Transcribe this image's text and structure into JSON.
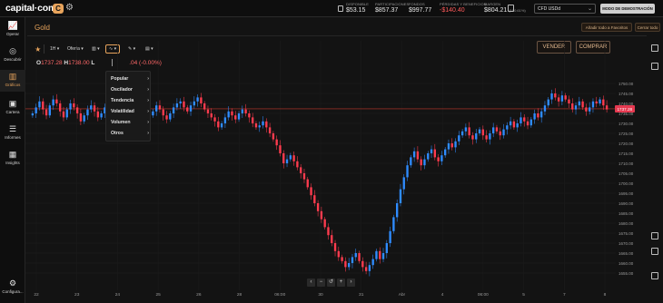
{
  "app": {
    "logo": "capital·com",
    "logo_badge": "C",
    "settings_icon": "gear-icon"
  },
  "account_stats": [
    {
      "label": "DISPONIBLE",
      "value": "$53.15",
      "sub": ""
    },
    {
      "label": "PARTICIPACIONES",
      "value": "$857.37",
      "sub": ""
    },
    {
      "label": "FONDOS",
      "value": "$997.77",
      "sub": ""
    },
    {
      "label": "PÉRDIDAS Y BENEFICIOS",
      "value": "-$140.40",
      "sub": ""
    },
    {
      "label": "MARGEN",
      "value": "$804.21",
      "sub": "(100.61%)"
    }
  ],
  "account_select": "CFD USDd",
  "demo_mode": "MODO DE DEMOSTRACIÓN",
  "nav": [
    {
      "label": "Operar",
      "icon": "chart-line-icon"
    },
    {
      "label": "Descubrir",
      "icon": "compass-icon"
    },
    {
      "label": "Gráficos",
      "icon": "candles-icon"
    },
    {
      "label": "Cartera",
      "icon": "briefcase-icon"
    },
    {
      "label": "Informes",
      "icon": "report-icon"
    },
    {
      "label": "Insights",
      "icon": "insights-icon"
    },
    {
      "label": "Configura...",
      "icon": "settings-icon"
    }
  ],
  "instrument": "Gold",
  "header_buttons": {
    "favorites": "Añadir todo a Favoritos",
    "close_all": "Cerrar todo"
  },
  "toolbar": {
    "timeframe": "1H",
    "price_type": "Oferta",
    "chart_type_icon": "candles-icon",
    "indicators_icon": "indicators-icon",
    "draw_icon": "pencil-icon",
    "template_icon": "layers-icon"
  },
  "trade": {
    "sell": "VENDER",
    "buy": "COMPRAR"
  },
  "ohlc": {
    "o_label": "O",
    "o": "1737.28",
    "h_label": "H",
    "h": "1738.00",
    "l_label": "L",
    "change": ".04 (-0.00%)"
  },
  "indicator_menu": [
    "Popular",
    "Oscilador",
    "Tendencia",
    "Volatilidad",
    "Volumen",
    "Otros"
  ],
  "colors": {
    "accent": "#e8a45c",
    "up": "#2f8cff",
    "down": "#ff3b4e",
    "price_tag": "#e53950",
    "price_line": "#c0392b"
  },
  "chart_data": {
    "type": "candlestick",
    "instrument": "Gold",
    "current_price_label": "1737.28",
    "ylim": [
      1650,
      1760
    ],
    "y_ticks": [
      1750,
      1745,
      1740,
      1735,
      1730,
      1725,
      1720,
      1715,
      1710,
      1705,
      1700,
      1695,
      1690,
      1685,
      1680,
      1675,
      1670,
      1665,
      1660,
      1655
    ],
    "x_ticks": [
      "22",
      "23",
      "24",
      "25",
      "26",
      "28",
      "06:00",
      "30",
      "31",
      "Abr",
      "4",
      "06:00",
      "5",
      "7",
      "8"
    ],
    "current_price": 1737.28,
    "series": [
      {
        "values": [
          1735,
          1738,
          1741,
          1737,
          1734,
          1739,
          1742,
          1740,
          1736,
          1733,
          1737,
          1740,
          1738,
          1735,
          1731,
          1734,
          1737,
          1739,
          1736,
          1733,
          1735,
          1738,
          1741,
          1739,
          1742,
          1744,
          1740,
          1737,
          1734,
          1731,
          1728,
          1732,
          1735,
          1737,
          1734,
          1736,
          1739,
          1737,
          1734,
          1732,
          1735,
          1738,
          1740,
          1741,
          1738,
          1736,
          1739,
          1741,
          1743,
          1740,
          1737,
          1735,
          1733,
          1731,
          1728,
          1730,
          1733,
          1736,
          1734,
          1732,
          1735,
          1737,
          1735,
          1733,
          1730,
          1728,
          1729,
          1731,
          1728,
          1725,
          1722,
          1719,
          1715,
          1710,
          1712,
          1714,
          1711,
          1708,
          1705,
          1702,
          1698,
          1694,
          1690,
          1686,
          1682,
          1678,
          1674,
          1670,
          1666,
          1663,
          1661,
          1658,
          1660,
          1663,
          1665,
          1661,
          1658,
          1656,
          1659,
          1662,
          1666,
          1662,
          1665,
          1670,
          1676,
          1683,
          1690,
          1697,
          1703,
          1709,
          1713,
          1716,
          1712,
          1709,
          1712,
          1715,
          1717,
          1713,
          1711,
          1714,
          1717,
          1720,
          1718,
          1721,
          1724,
          1726,
          1728,
          1724,
          1722,
          1725,
          1727,
          1724,
          1722,
          1725,
          1728,
          1726,
          1724,
          1727,
          1729,
          1731,
          1728,
          1730,
          1733,
          1731,
          1729,
          1732,
          1735,
          1733,
          1736,
          1739,
          1742,
          1745,
          1743,
          1741,
          1744,
          1742,
          1740,
          1737,
          1739,
          1741,
          1738,
          1736,
          1738,
          1741,
          1740,
          1742,
          1739,
          1737
        ]
      }
    ]
  }
}
